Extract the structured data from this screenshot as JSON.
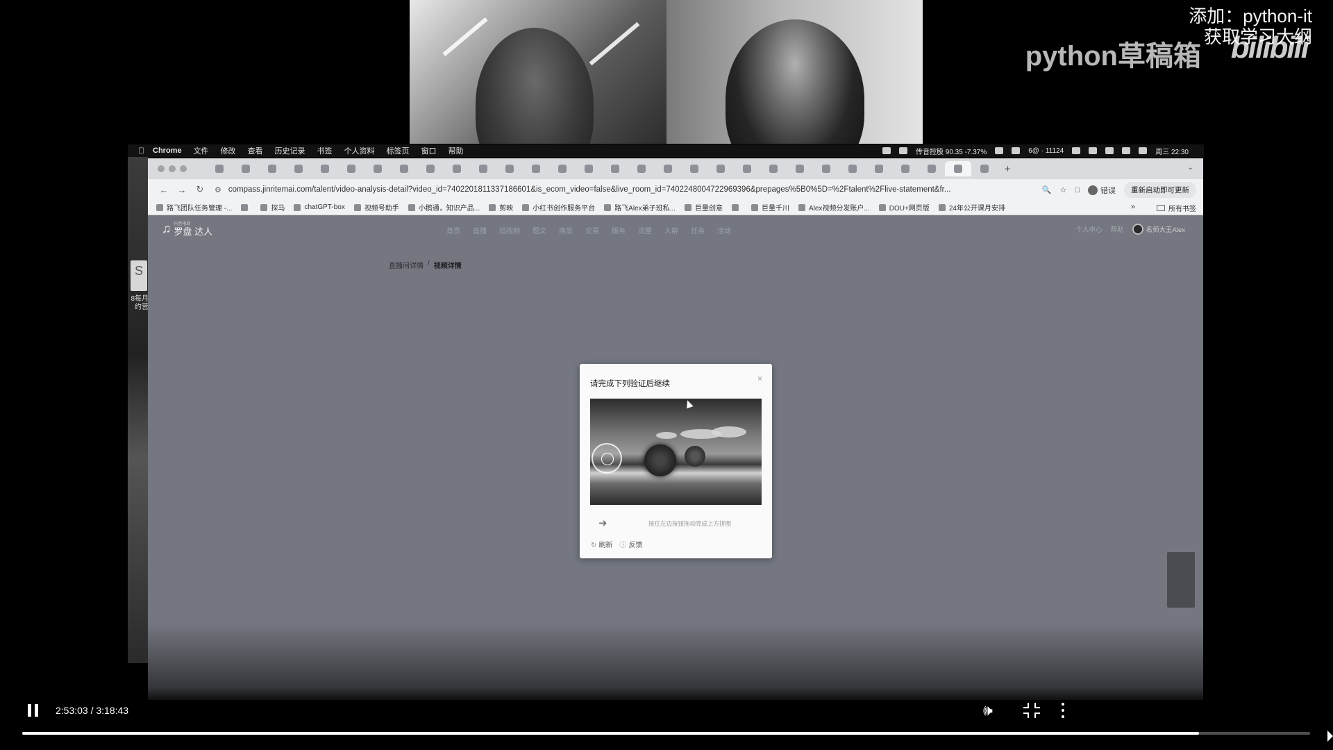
{
  "watermark": {
    "line1": "添加：python-it",
    "line2": "获取学习大纲",
    "channel": "python草稿箱",
    "logo": "bilibili"
  },
  "desktop": {
    "file_label": "8每月 约营"
  },
  "menubar": {
    "app": "Chrome",
    "items": [
      "文件",
      "修改",
      "查看",
      "历史记录",
      "书签",
      "个人资料",
      "标签页",
      "窗口",
      "帮助"
    ],
    "status": {
      "ticker": "传音控股 90.35 -7.37%",
      "counter": "6@ · 11124",
      "clock": "周三 22:30"
    }
  },
  "browser": {
    "tab_count": 30,
    "active_tab_index": 28,
    "url": "compass.jinritemai.com/talent/video-analysis-detail?video_id=7402201811337186601&is_ecom_video=false&live_room_id=7402248004722969396&prepages%5B0%5D=%2Ftalent%2Flive-statement&fr...",
    "profile_status": "错误",
    "update_label": "重新启动即可更新"
  },
  "bookmarks": {
    "items": [
      "路飞团队任务管理 -...",
      "",
      "探马",
      "chatGPT-box",
      "视频号助手",
      "小鹅通，知识产品...",
      "剪映",
      "小红书创作服务平台",
      "路飞Alex弟子班私...",
      "巨量创意",
      "",
      "巨量千川",
      "Alex视频分发账户...",
      "DOU+网页版",
      "24年公开课月安排"
    ],
    "all_label": "所有书签"
  },
  "site": {
    "logo": "罗盘 达人",
    "logo_sub": "抖音电商",
    "nav": [
      "首页",
      "直播",
      "短视频",
      "图文",
      "商品",
      "交易",
      "服务",
      "流量",
      "人群",
      "任务",
      "活动"
    ],
    "header_links": [
      "个人中心",
      "帮助"
    ],
    "user": "名师大王Alex",
    "breadcrumb": [
      "直播间详情",
      "视频详情"
    ],
    "breadcrumb_sep": "/"
  },
  "captcha": {
    "title": "请完成下列验证后继续",
    "hint": "按住左边按钮拖动完成上方拼图",
    "refresh": "刷新",
    "feedback": "反馈"
  },
  "player": {
    "time": "2:53:03 / 3:18:43",
    "progress_fraction": 0.9135
  }
}
